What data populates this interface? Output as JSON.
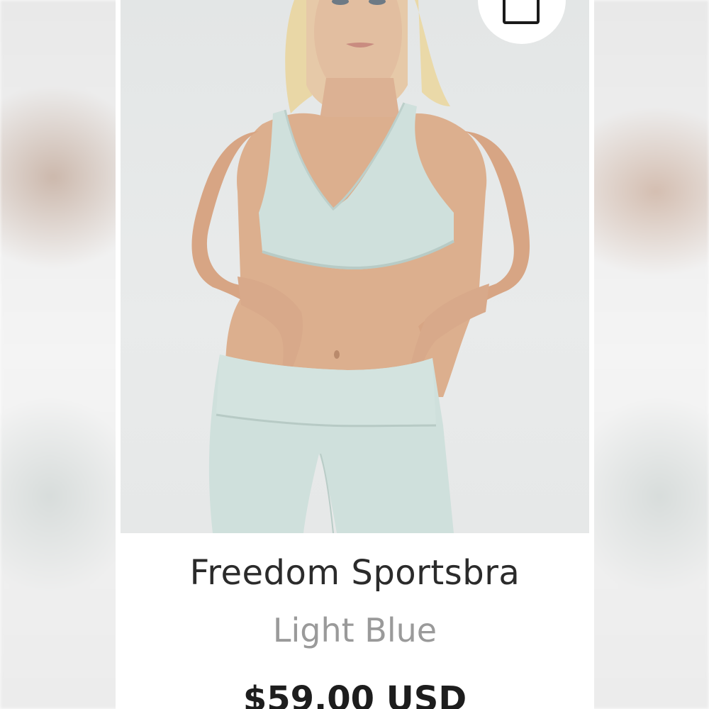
{
  "product": {
    "name": "Freedom Sportsbra",
    "variant": "Light Blue",
    "price": "$59.00 USD",
    "image_alt": "Model wearing the Freedom Sportsbra and matching leggings"
  },
  "icons": {
    "cart": "shopping-bag-icon"
  },
  "colors": {
    "garment": "#cfe0dc",
    "title_text": "#2b2b2b",
    "variant_text": "#9a9a9a",
    "price_text": "#1d1d1d"
  }
}
